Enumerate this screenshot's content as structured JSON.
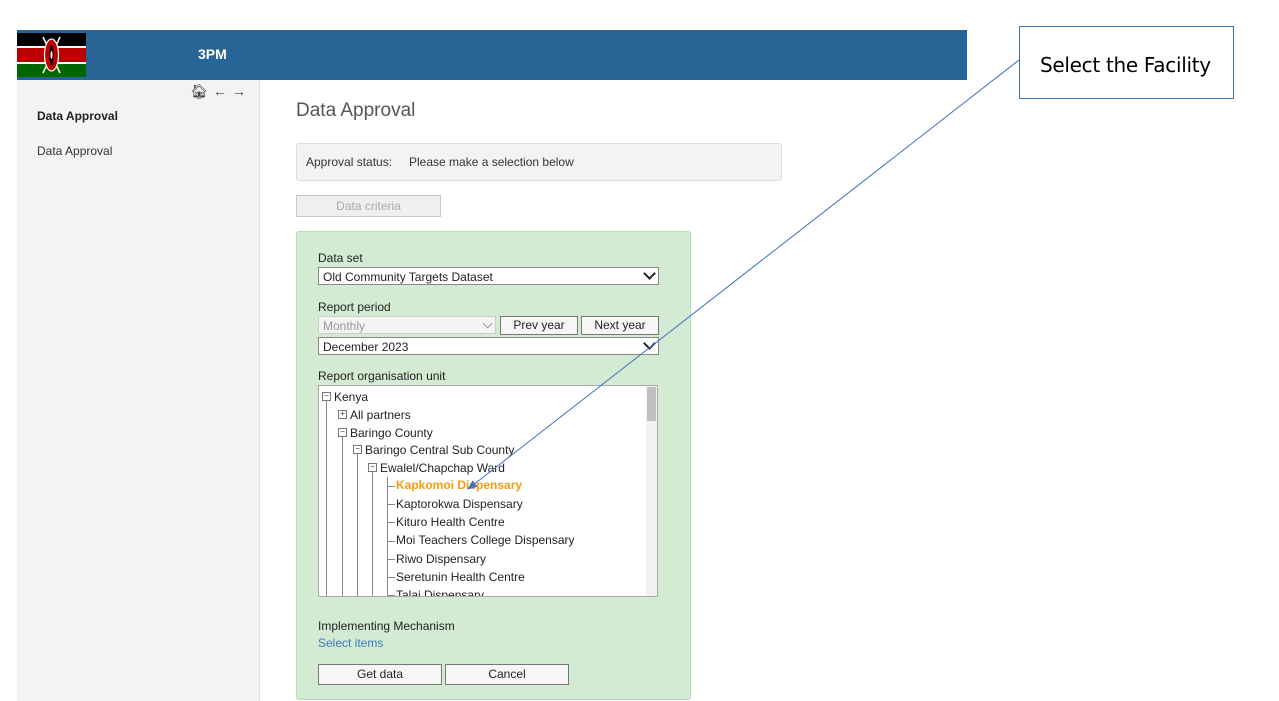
{
  "app": {
    "title": "3PM"
  },
  "nav_icons": [
    "home-icon",
    "arrow-left-icon",
    "arrow-right-icon"
  ],
  "sidebar": {
    "heading": "Data Approval",
    "items": [
      {
        "label": "Data Approval"
      }
    ]
  },
  "main": {
    "title": "Data Approval",
    "approval_status_label": "Approval status:",
    "approval_status_value": "Please make a selection below",
    "criteria_button": "Data criteria",
    "form": {
      "dataset_label": "Data set",
      "dataset_value": "Old Community Targets Dataset",
      "period_label": "Report period",
      "period_type": "Monthly",
      "prev_year": "Prev year",
      "next_year": "Next year",
      "period_value": "December 2023",
      "orgunit_label": "Report organisation unit",
      "tree": [
        {
          "label": "Kenya",
          "expanded": true
        },
        {
          "label": "All partners",
          "expanded": false
        },
        {
          "label": "Baringo County",
          "expanded": true
        },
        {
          "label": "Baringo Central Sub County",
          "expanded": true
        },
        {
          "label": "Ewalel/Chapchap Ward",
          "expanded": true
        },
        {
          "label": "Kapkomoi Dispensary",
          "selected": true
        },
        {
          "label": "Kaptorokwa Dispensary"
        },
        {
          "label": "Kituro Health Centre"
        },
        {
          "label": "Moi Teachers College Dispensary"
        },
        {
          "label": "Riwo Dispensary"
        },
        {
          "label": "Seretunin Health Centre"
        },
        {
          "label": "Talai Dispensary"
        }
      ],
      "mechanism_label": "Implementing Mechanism",
      "mechanism_link": "Select items",
      "get_data": "Get data",
      "cancel": "Cancel"
    }
  },
  "annotation": {
    "text": "Select the Facility"
  },
  "colors": {
    "topbar": "#276596",
    "panel": "#d3ead3",
    "selected": "#f39c12",
    "link": "#3b7bbf"
  }
}
